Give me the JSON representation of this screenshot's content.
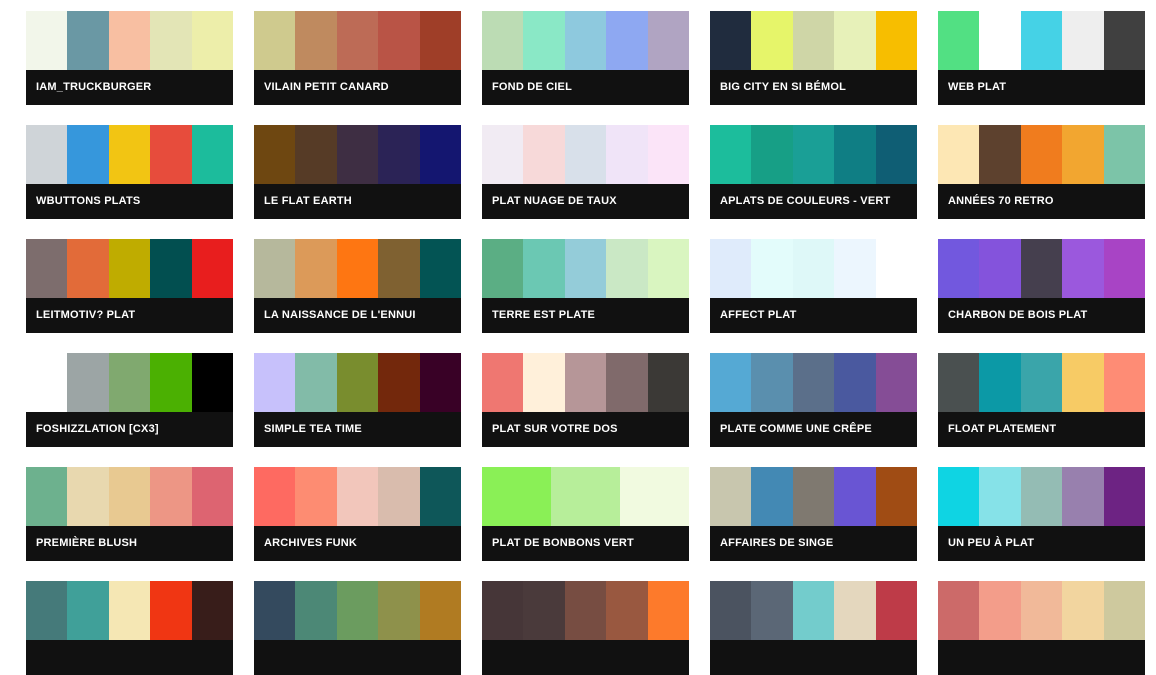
{
  "palettes": [
    {
      "name": "IAM_TRUCKBURGER",
      "colors": [
        "#f2f6ea",
        "#6a98a4",
        "#f8bfa2",
        "#e3e5b6",
        "#edeeaa"
      ]
    },
    {
      "name": "VILAIN PETIT CANARD",
      "colors": [
        "#cfca8e",
        "#bf8a5f",
        "#bd6b56",
        "#b95446",
        "#9f3e28"
      ]
    },
    {
      "name": "FOND DE CIEL",
      "colors": [
        "#bcdcb4",
        "#8ae8c6",
        "#8ec9de",
        "#8ea8f2",
        "#b0a4c2"
      ]
    },
    {
      "name": "BIG CITY EN SI BÉMOL",
      "colors": [
        "#202c3e",
        "#e6f56a",
        "#cfd6a7",
        "#e7f1b9",
        "#f7be00"
      ]
    },
    {
      "name": "WEB PLAT",
      "colors": [
        "#52e083",
        "#ffffff",
        "#45d2e6",
        "#eeeeee",
        "#404040"
      ]
    },
    {
      "name": "WBUTTONS PLATS",
      "colors": [
        "#cfd4d8",
        "#3697dc",
        "#f2c513",
        "#e74c3c",
        "#1cbc9c"
      ]
    },
    {
      "name": "LE FLAT EARTH",
      "colors": [
        "#6e4711",
        "#563b26",
        "#3e2e43",
        "#2b2356",
        "#141670"
      ]
    },
    {
      "name": "PLAT NUAGE DE TAUX",
      "colors": [
        "#f1ebf3",
        "#f7d9d9",
        "#d8e0ea",
        "#f0e4f8",
        "#fbe4f8"
      ]
    },
    {
      "name": "APLATS DE COULEURS - VERT",
      "colors": [
        "#1cbd9c",
        "#179f86",
        "#1a9f96",
        "#0f7e84",
        "#0f5e74"
      ]
    },
    {
      "name": "ANNÉES 70 RETRO",
      "colors": [
        "#fde7b4",
        "#5d412e",
        "#f07c1e",
        "#f2a630",
        "#7cc4a8"
      ]
    },
    {
      "name": "LEITMOTIV? PLAT",
      "colors": [
        "#7d6d6d",
        "#e26b39",
        "#bfac00",
        "#024f50",
        "#e81e1e"
      ]
    },
    {
      "name": "LA NAISSANCE DE L'ENNUI",
      "colors": [
        "#b6b89c",
        "#dc9a59",
        "#fe7612",
        "#7f6131",
        "#035454"
      ]
    },
    {
      "name": "TERRE EST PLATE",
      "colors": [
        "#5bae84",
        "#6bc8b3",
        "#94ccd9",
        "#cae8c5",
        "#d9f5c0"
      ]
    },
    {
      "name": "AFFECT PLAT",
      "colors": [
        "#dfebfb",
        "#e3fcfb",
        "#def8f8",
        "#ecf6fe",
        "#ffffff"
      ]
    },
    {
      "name": "CHARBON DE BOIS PLAT",
      "colors": [
        "#7258de",
        "#8453dc",
        "#453f4e",
        "#9b58dd",
        "#a844c5"
      ]
    },
    {
      "name": "FOSHIZZLATION [CX3]",
      "colors": [
        "#ffffff",
        "#9ca5a5",
        "#80a96f",
        "#4bb002",
        "#000000"
      ]
    },
    {
      "name": "SIMPLE TEA TIME",
      "colors": [
        "#c7c1fb",
        "#82bba8",
        "#798d2e",
        "#73280c",
        "#390126"
      ]
    },
    {
      "name": "PLAT SUR VOTRE DOS",
      "colors": [
        "#ef7771",
        "#fff0da",
        "#b69698",
        "#806a6b",
        "#3b3936"
      ]
    },
    {
      "name": "PLATE COMME UNE CRÊPE",
      "colors": [
        "#55a9d4",
        "#5a8fae",
        "#5b6f8a",
        "#4a599f",
        "#854d96"
      ]
    },
    {
      "name": "FLOAT PLATEMENT",
      "colors": [
        "#4a5050",
        "#0c99a6",
        "#3aa5aa",
        "#f7cb65",
        "#fe8c75"
      ]
    },
    {
      "name": "PREMIÈRE BLUSH",
      "colors": [
        "#6db18e",
        "#e8d8af",
        "#e8c991",
        "#ed9685",
        "#dd6471"
      ]
    },
    {
      "name": "ARCHIVES FUNK",
      "colors": [
        "#fe6a61",
        "#fd8c72",
        "#f2c6bb",
        "#d9bcad",
        "#0e5759"
      ]
    },
    {
      "name": "PLAT DE BONBONS VERT",
      "colors": [
        "#8af056",
        "#b7ee9a",
        "#f1fae0"
      ]
    },
    {
      "name": "AFFAIRES DE SINGE",
      "colors": [
        "#c8c6ae",
        "#4389b4",
        "#7f7970",
        "#6955d3",
        "#a04c14"
      ]
    },
    {
      "name": "UN PEU À PLAT",
      "colors": [
        "#0fd4e3",
        "#86e2e8",
        "#94bcb4",
        "#9880ae",
        "#6d2383"
      ]
    },
    {
      "name": "",
      "colors": [
        "#457a7a",
        "#40a099",
        "#f5e7b4",
        "#f03613",
        "#381d1a"
      ]
    },
    {
      "name": "",
      "colors": [
        "#344a5e",
        "#4c8876",
        "#6b9c5f",
        "#8e914b",
        "#b07b22"
      ]
    },
    {
      "name": "",
      "colors": [
        "#463638",
        "#4a3a3b",
        "#774d42",
        "#995840",
        "#fd7a2b"
      ]
    },
    {
      "name": "",
      "colors": [
        "#4b5360",
        "#5b6776",
        "#73cccc",
        "#e4d7be",
        "#be3b48"
      ]
    },
    {
      "name": "",
      "colors": [
        "#cc6a69",
        "#f39d8a",
        "#f1b999",
        "#f2d59f",
        "#cec99e"
      ]
    }
  ]
}
